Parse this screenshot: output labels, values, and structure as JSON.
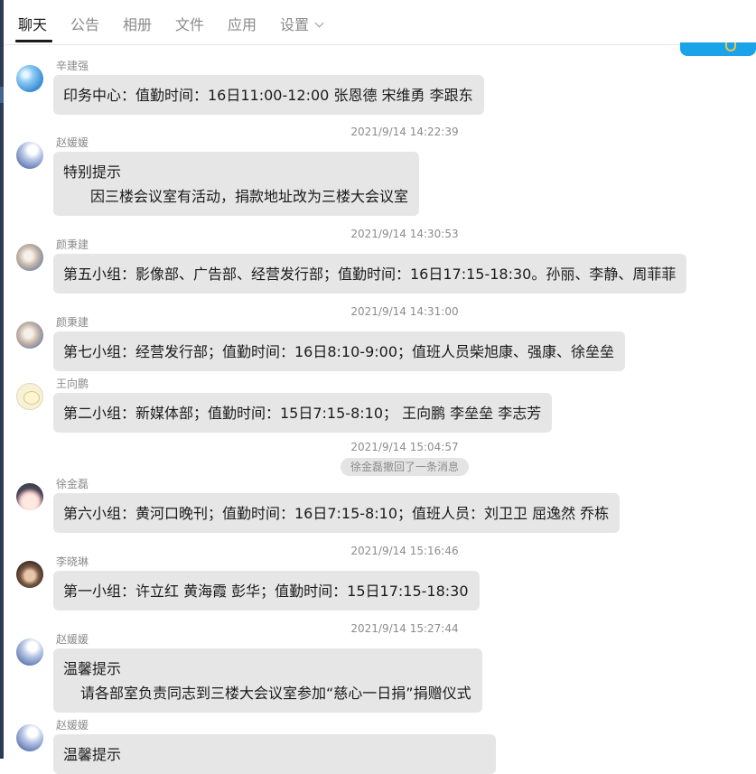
{
  "tabs": [
    {
      "label": "聊天",
      "active": true
    },
    {
      "label": "公告",
      "active": false
    },
    {
      "label": "相册",
      "active": false
    },
    {
      "label": "文件",
      "active": false
    },
    {
      "label": "应用",
      "active": false
    },
    {
      "label": "设置",
      "active": false,
      "has_dropdown": true
    }
  ],
  "messages": [
    {
      "sender": "辛建强",
      "avatar": "earth-avatar",
      "lines": [
        "印务中心：值勤时间：16日11:00-12:00  张恩德  宋维勇 李跟东"
      ]
    },
    {
      "timestamp": "2021/9/14 14:22:39",
      "sender": "赵媛媛",
      "avatar": "flower-avatar",
      "lines": [
        "特别提示",
        "因三楼会议室有活动，捐款地址改为三楼大会议室"
      ]
    },
    {
      "timestamp": "2021/9/14 14:30:53",
      "sender": "颜秉建",
      "avatar": "tree-avatar",
      "lines": [
        "第五小组：影像部、广告部、经营发行部；值勤时间：16日17:15-18:30。孙丽、李静、周菲菲"
      ]
    },
    {
      "timestamp": "2021/9/14 14:31:00",
      "sender": "颜秉建",
      "avatar": "tree-avatar",
      "lines": [
        "第七小组：经营发行部；值勤时间：16日8:10-9:00；值班人员柴旭康、强康、徐垒垒"
      ]
    },
    {
      "sender": "王向鹏",
      "avatar": "sheep-avatar",
      "lines": [
        " 第二小组：新媒体部；值勤时间：15日7:15-8:10；  王向鹏 李垒垒 李志芳"
      ]
    },
    {
      "timestamp": "2021/9/14 15:04:57",
      "recall_notice": "徐金磊撤回了一条消息"
    },
    {
      "sender": "徐金磊",
      "avatar": "cartoon-girl-avatar",
      "lines": [
        " 第六小组：黄河口晚刊；值勤时间：16日7:15-8:10；值班人员：刘卫卫 屈逸然 乔栋"
      ]
    },
    {
      "timestamp": "2021/9/14 15:16:46",
      "sender": "李晓琳",
      "avatar": "photo-avatar",
      "lines": [
        "第一小组：许立红 黄海霞 彭华；值勤时间：15日17:15-18:30"
      ]
    },
    {
      "timestamp": "2021/9/14 15:27:44",
      "sender": "赵媛媛",
      "avatar": "flower-avatar",
      "lines": [
        "温馨提示",
        "  请各部室负责同志到三楼大会议室参加“慈心一日捐”捐赠仪式"
      ]
    },
    {
      "sender": "赵媛媛",
      "avatar": "flower-avatar",
      "lines": [
        "温馨提示"
      ]
    }
  ]
}
